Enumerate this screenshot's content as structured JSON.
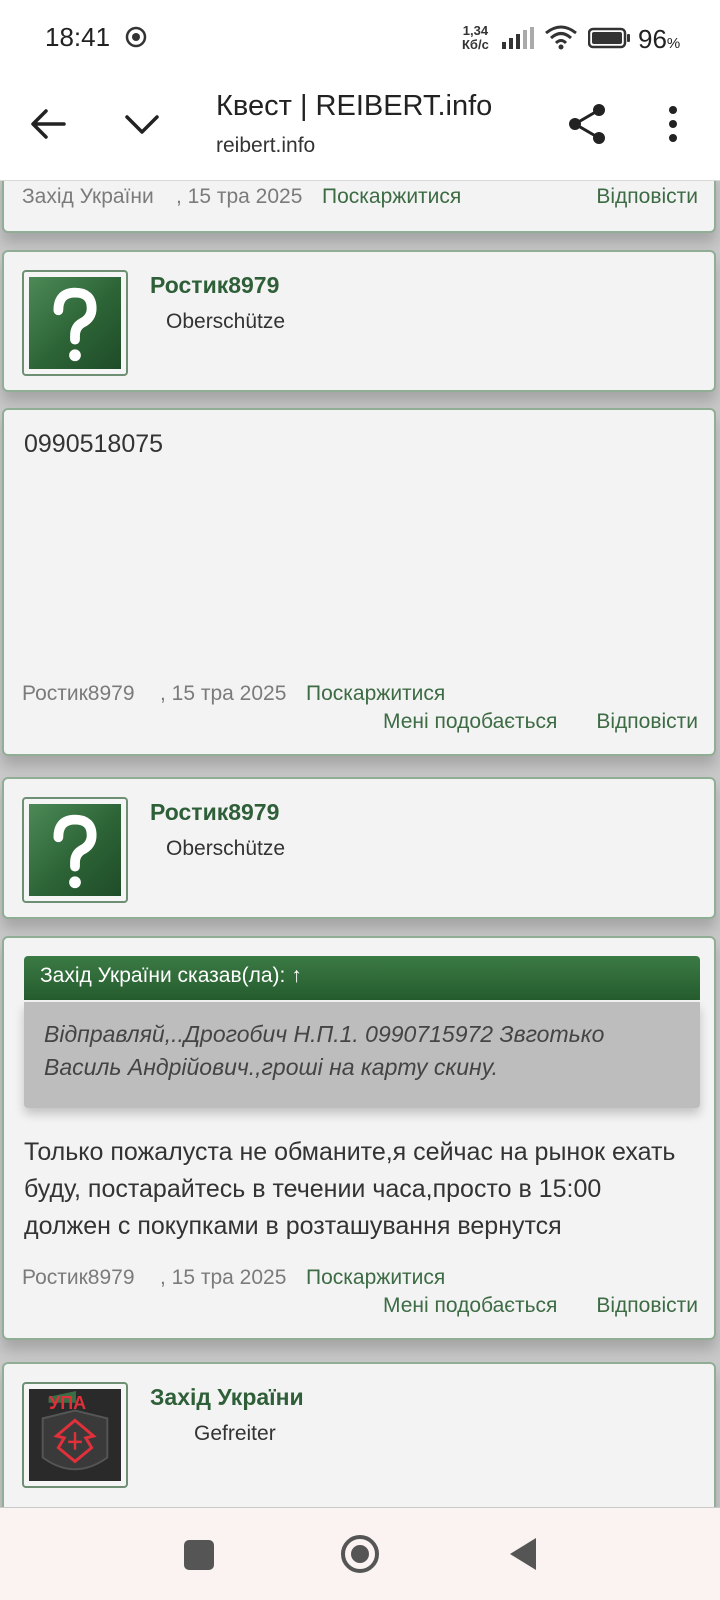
{
  "status_bar": {
    "time": "18:41",
    "speed_value": "1,34",
    "speed_unit": "Кб/с",
    "battery_value": "96",
    "battery_unit": "%"
  },
  "browser": {
    "title": "Квест | REIBERT.info",
    "url": "reibert.info"
  },
  "posts": [
    {
      "author": "Захід України",
      "date": ", 15 тра 2025",
      "report_label": "Поскаржитися",
      "reply_label": "Відповісти"
    },
    {
      "author": "Ростик8979",
      "rank": "Oberschütze",
      "body": "0990518075",
      "date": ", 15 тра 2025",
      "report_label": "Поскаржитися",
      "like_label": "Мені подобається",
      "reply_label": "Відповісти"
    },
    {
      "author": "Ростик8979",
      "rank": "Oberschütze",
      "quote_header": "Захід України сказав(ла): ↑",
      "quote_text": "Відправляй,..Дрогобич Н.П.1. 0990715972 Звготько Василь Андрійович.,гроші на карту скину.",
      "body": "Только пожалуста не обманите,я сейчас на рынок ехать буду, постарайтесь в течении часа,просто в 15:00 должен с покупками в розташування вернутся",
      "date": ", 15 тра 2025",
      "report_label": "Поскаржитися",
      "like_label": "Мені подобається",
      "reply_label": "Відповісти"
    },
    {
      "author": "Захід України",
      "rank": "Gefreiter",
      "avatar_text": "УПА"
    }
  ],
  "colors": {
    "accent_green": "#2f5f38",
    "link_green": "#3c6b44",
    "quote_header": "#2c6a35"
  }
}
